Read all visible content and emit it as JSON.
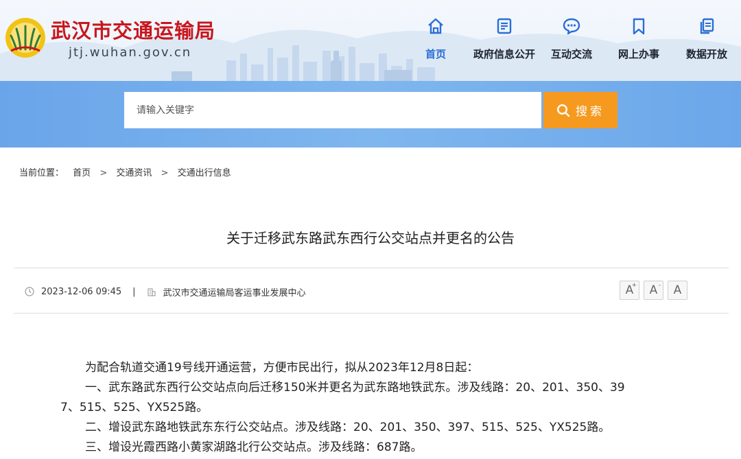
{
  "header": {
    "site_title": "武汉市交通运输局",
    "site_domain": "jtj.wuhan.gov.cn",
    "brand_color": "#c9161d",
    "accent_color": "#2a6ed6"
  },
  "nav": {
    "items": [
      {
        "label": "首页",
        "icon": "home-icon",
        "active": true
      },
      {
        "label": "政府信息公开",
        "icon": "document-list-icon",
        "active": false
      },
      {
        "label": "互动交流",
        "icon": "chat-bubble-icon",
        "active": false
      },
      {
        "label": "网上办事",
        "icon": "bookmark-icon",
        "active": false
      },
      {
        "label": "数据开放",
        "icon": "data-copy-icon",
        "active": false
      }
    ]
  },
  "search": {
    "placeholder": "请输入关键字",
    "button_label": "搜索",
    "button_color": "#f59a1f"
  },
  "breadcrumb": {
    "prefix": "当前位置：",
    "items": [
      "首页",
      "交通资讯",
      "交通出行信息"
    ],
    "separator": ">"
  },
  "article": {
    "title": "关于迁移武东路武东西行公交站点并更名的公告",
    "date": "2023-12-06 09:45",
    "meta_separator": "|",
    "source": "武汉市交通运输局客运事业发展中心",
    "font_size_buttons": [
      "A",
      "A",
      "A"
    ],
    "font_size_superscripts": [
      "+",
      "-",
      ""
    ],
    "paragraphs": [
      "为配合轨道交通19号线开通运营，方便市民出行，拟从2023年12月8日起：",
      "一、武东路武东西行公交站点向后迁移150米并更名为武东路地铁武东。涉及线路：20、201、350、39",
      "7、515、525、YX525路。",
      "二、增设武东路地铁武东东行公交站点。涉及线路：20、201、350、397、515、525、YX525路。",
      "三、增设光霞西路小黄家湖路北行公交站点。涉及线路：687路。"
    ]
  }
}
